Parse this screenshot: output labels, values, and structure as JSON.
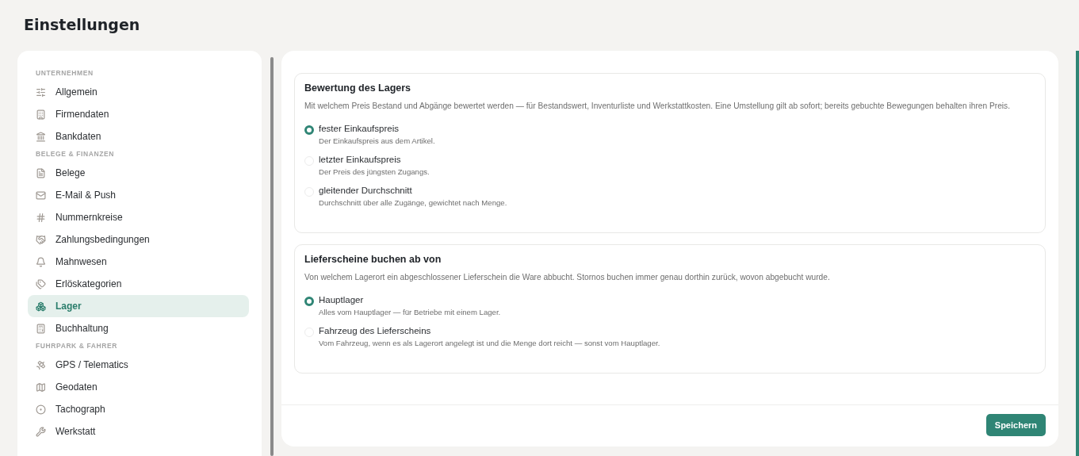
{
  "page_title": "Einstellungen",
  "sidebar": {
    "sections": [
      {
        "title": "UNTERNEHMEN",
        "items": [
          {
            "label": "Allgemein",
            "selected": false
          },
          {
            "label": "Firmendaten",
            "selected": false
          },
          {
            "label": "Bankdaten",
            "selected": false
          }
        ]
      },
      {
        "title": "BELEGE & FINANZEN",
        "items": [
          {
            "label": "Belege",
            "selected": false
          },
          {
            "label": "E-Mail & Push",
            "selected": false
          },
          {
            "label": "Nummernkreise",
            "selected": false
          },
          {
            "label": "Zahlungsbedingungen",
            "selected": false
          },
          {
            "label": "Mahnwesen",
            "selected": false
          },
          {
            "label": "Erlöskategorien",
            "selected": false
          },
          {
            "label": "Lager",
            "selected": true
          },
          {
            "label": "Buchhaltung",
            "selected": false
          }
        ]
      },
      {
        "title": "FUHRPARK & FAHRER",
        "items": [
          {
            "label": "GPS / Telematics",
            "selected": false
          },
          {
            "label": "Geodaten",
            "selected": false
          },
          {
            "label": "Tachograph",
            "selected": false
          },
          {
            "label": "Werkstatt",
            "selected": false
          }
        ]
      }
    ]
  },
  "groups": [
    {
      "title": "Bewertung des Lagers",
      "description": "Mit welchem Preis Bestand und Abgänge bewertet werden — für Bestandswert, Inventurliste und Werkstattkosten. Eine Umstellung gilt ab sofort; bereits gebuchte Bewegungen behalten ihren Preis.",
      "options": [
        {
          "label": "fester Einkaufspreis",
          "hint": "Der Einkaufspreis aus dem Artikel.",
          "selected": true
        },
        {
          "label": "letzter Einkaufspreis",
          "hint": "Der Preis des jüngsten Zugangs.",
          "selected": false
        },
        {
          "label": "gleitender Durchschnitt",
          "hint": "Durchschnitt über alle Zugänge, gewichtet nach Menge.",
          "selected": false
        }
      ]
    },
    {
      "title": "Lieferscheine buchen ab von",
      "description": "Von welchem Lagerort ein abgeschlossener Lieferschein die Ware abbucht. Stornos buchen immer genau dorthin zurück, wovon abgebucht wurde.",
      "options": [
        {
          "label": "Hauptlager",
          "hint": "Alles vom Hauptlager — für Betriebe mit einem Lager.",
          "selected": true
        },
        {
          "label": "Fahrzeug des Lieferscheins",
          "hint": "Vom Fahrzeug, wenn es als Lagerort angelegt ist und die Menge dort reicht — sonst vom Hauptlager.",
          "selected": false
        }
      ]
    }
  ],
  "save_button": "Speichern"
}
